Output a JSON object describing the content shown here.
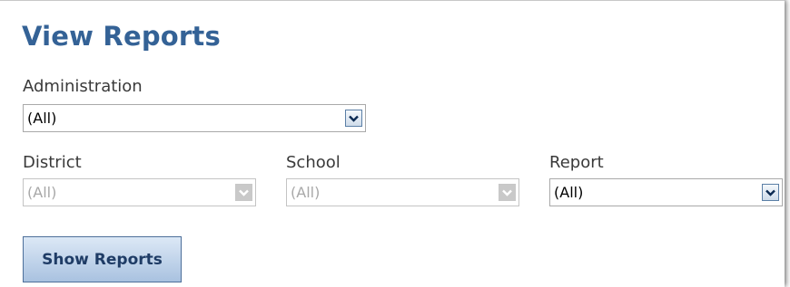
{
  "page": {
    "title": "View Reports"
  },
  "filters": {
    "administration": {
      "label": "Administration",
      "value": "(All)",
      "enabled": true
    },
    "district": {
      "label": "District",
      "value": "(All)",
      "enabled": false
    },
    "school": {
      "label": "School",
      "value": "(All)",
      "enabled": false
    },
    "report": {
      "label": "Report",
      "value": "(All)",
      "enabled": true
    }
  },
  "actions": {
    "show_reports_label": "Show Reports"
  },
  "colors": {
    "title": "#346296",
    "button_text": "#1f3c66",
    "disabled_text": "#a8a8a8"
  },
  "icons": {
    "dropdown": "chevron-down-icon"
  }
}
